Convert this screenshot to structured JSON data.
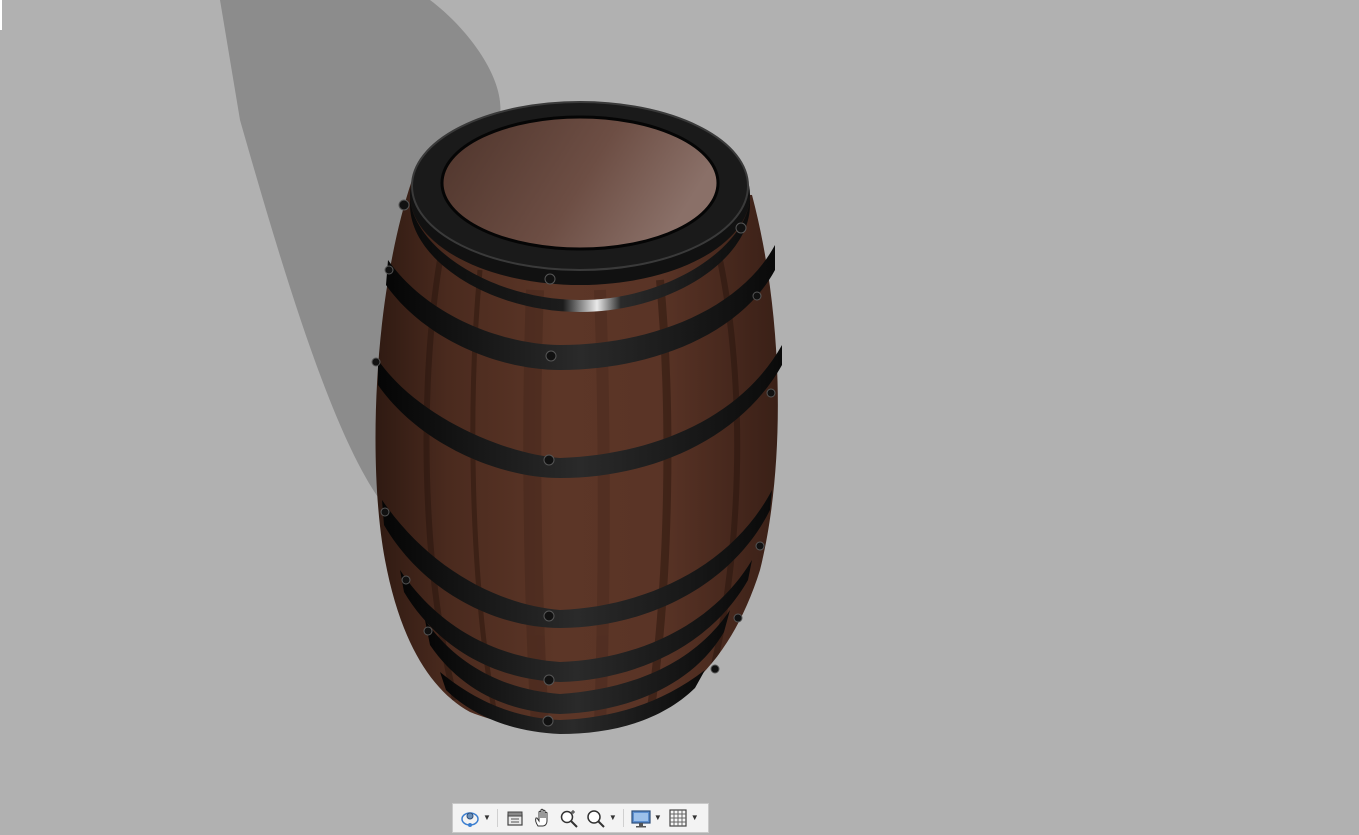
{
  "viewport": {
    "background": "#b1b1b1",
    "model": "barrel"
  },
  "barrel": {
    "wood_color": "#5a3426",
    "lid_color": "#6d4e44",
    "band_color": "#161616",
    "shadow_color": "#8c8c8c"
  },
  "toolbar": {
    "tools": [
      {
        "icon": "orbit-icon",
        "has_dropdown": true
      },
      {
        "icon": "look-at-icon",
        "has_dropdown": false
      },
      {
        "icon": "pan-hand-icon",
        "has_dropdown": false
      },
      {
        "icon": "zoom-window-icon",
        "has_dropdown": false
      },
      {
        "icon": "zoom-fit-icon",
        "has_dropdown": true
      },
      {
        "icon": "display-settings-icon",
        "has_dropdown": true
      },
      {
        "icon": "grid-snap-icon",
        "has_dropdown": true
      }
    ],
    "accent": "#3c7fd0"
  }
}
